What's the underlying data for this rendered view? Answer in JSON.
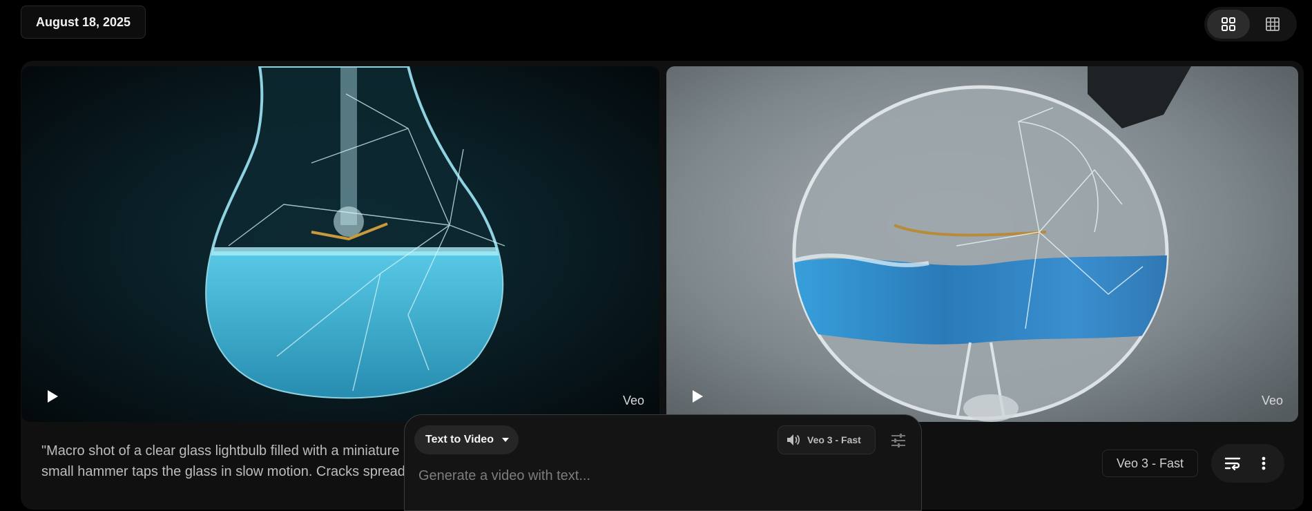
{
  "header": {
    "date": "August 18, 2025",
    "view_toggle": {
      "grid_large_icon": "grid-2x2-icon",
      "grid_small_icon": "grid-3x3-icon",
      "active": "grid-2x2"
    }
  },
  "videos": [
    {
      "badge": "Veo",
      "play_icon": "play-icon",
      "description": "cracked lightbulb filled with blue water, dark background"
    },
    {
      "badge": "Veo",
      "play_icon": "play-icon",
      "description": "lightbulb with shattering glass and blue water, grey background"
    }
  ],
  "prompt": {
    "line1": "\"Macro shot of a clear glass lightbulb filled with a miniature",
    "line2": "small hammer taps the glass in slow motion. Cracks spread"
  },
  "result_meta": {
    "model_label": "Veo 3 - Fast",
    "reuse_icon": "reuse-prompt-icon",
    "more_icon": "more-vert-icon"
  },
  "composer": {
    "mode_label": "Text to Video",
    "mode_icon": "caret-down-icon",
    "model_label": "Veo 3 - Fast",
    "model_icon": "speaker-icon",
    "settings_icon": "sliders-icon",
    "placeholder": "Generate a video with text..."
  },
  "colors": {
    "background": "#000000",
    "card": "#101010",
    "water_blue": "#3ab8e0"
  }
}
